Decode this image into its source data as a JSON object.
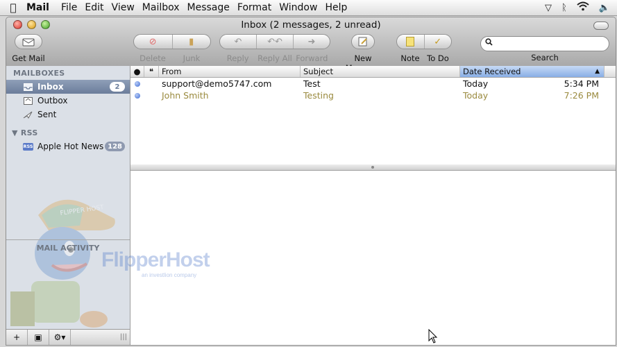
{
  "menubar": {
    "app": "Mail",
    "items": [
      "File",
      "Edit",
      "View",
      "Mailbox",
      "Message",
      "Format",
      "Window",
      "Help"
    ]
  },
  "window": {
    "title": "Inbox (2 messages, 2 unread)"
  },
  "toolbar": {
    "get_mail": "Get Mail",
    "delete": "Delete",
    "junk": "Junk",
    "reply": "Reply",
    "reply_all": "Reply All",
    "forward": "Forward",
    "new_message": "New Message",
    "note": "Note",
    "todo": "To Do",
    "search_label": "Search",
    "search_value": ""
  },
  "sidebar": {
    "mailboxes_heading": "MAILBOXES",
    "mailboxes": [
      {
        "label": "Inbox",
        "badge": "2",
        "icon": "inbox-icon"
      },
      {
        "label": "Outbox",
        "icon": "outbox-icon"
      },
      {
        "label": "Sent",
        "icon": "sent-icon"
      }
    ],
    "rss_heading": "RSS",
    "rss_feeds": [
      {
        "label": "Apple Hot News",
        "badge": "128",
        "icon": "rss-icon",
        "icon_text": "RSS"
      }
    ],
    "activity_heading": "MAIL ACTIVITY"
  },
  "message_list": {
    "columns": {
      "from": "From",
      "subject": "Subject",
      "date": "Date Received"
    },
    "rows": [
      {
        "from": "support@demo5747.com",
        "subject": "Test",
        "date": "Today",
        "time": "5:34 PM"
      },
      {
        "from": "John Smith",
        "subject": "Testing",
        "date": "Today",
        "time": "7:26 PM"
      }
    ]
  },
  "watermark": {
    "brand": "FlipperHost",
    "tagline": "an investlion company",
    "cap_text": "FLIPPER HOST"
  },
  "colors": {
    "selection": "#6b7d9b",
    "unread_dot": "#3e6bd4",
    "row_old_text": "#9a8a3e",
    "sort_header": "#88aee6"
  }
}
